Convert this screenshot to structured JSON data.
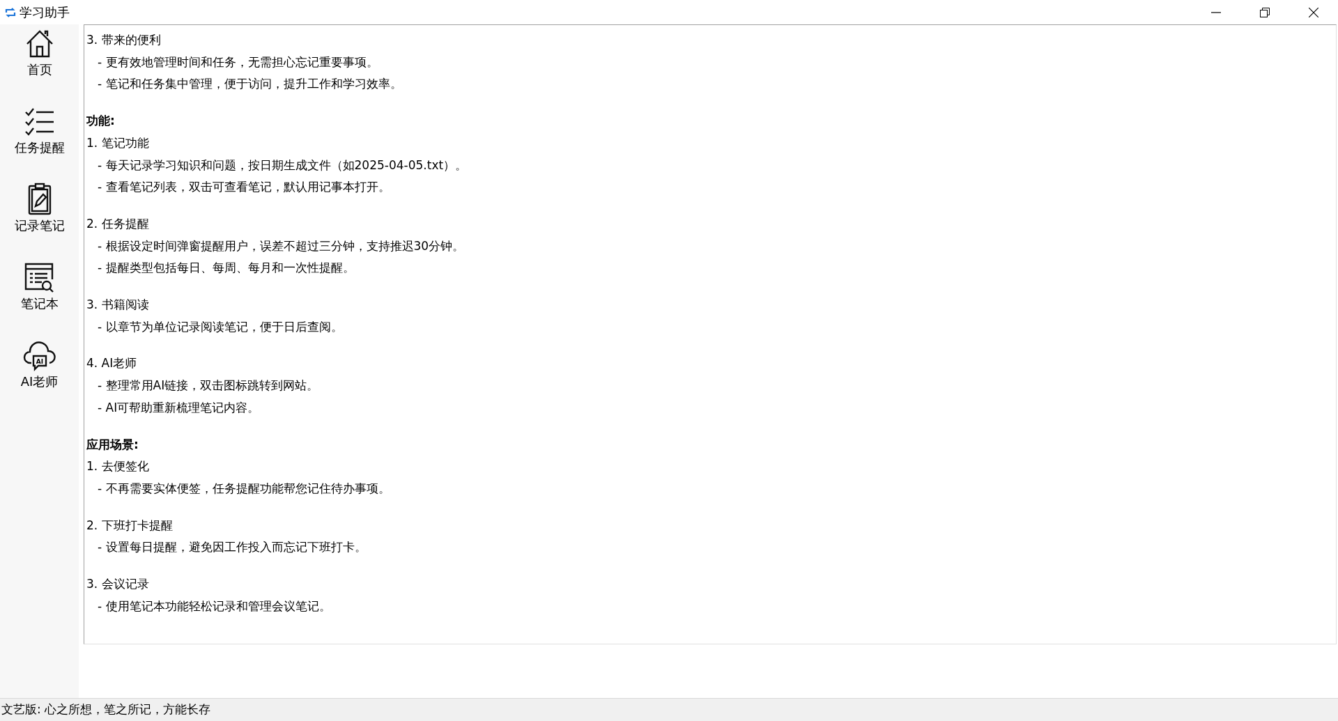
{
  "window": {
    "title": "学习助手"
  },
  "sidebar": {
    "items": [
      {
        "kind": "home",
        "label": "首页"
      },
      {
        "kind": "checklist",
        "label": "任务提醒"
      },
      {
        "kind": "clipboard",
        "label": "记录笔记"
      },
      {
        "kind": "notebook",
        "label": "笔记本"
      },
      {
        "kind": "cloud",
        "label": "AI老师",
        "icon_text": "AI"
      }
    ]
  },
  "content": {
    "groups": [
      {
        "items": [
          {
            "title": "3. 带来的便利",
            "bullets": [
              "- 更有效地管理时间和任务，无需担心忘记重要事项。",
              "- 笔记和任务集中管理，便于访问，提升工作和学习效率。"
            ]
          }
        ]
      },
      {
        "heading": "功能:",
        "items": [
          {
            "title": "1. 笔记功能",
            "bullets": [
              "- 每天记录学习知识和问题，按日期生成文件（如2025-04-05.txt）。",
              "- 查看笔记列表，双击可查看笔记，默认用记事本打开。"
            ]
          },
          {
            "title": "2. 任务提醒",
            "bullets": [
              "- 根据设定时间弹窗提醒用户，误差不超过三分钟，支持推迟30分钟。",
              "- 提醒类型包括每日、每周、每月和一次性提醒。"
            ]
          },
          {
            "title": "3. 书籍阅读",
            "bullets": [
              "- 以章节为单位记录阅读笔记，便于日后查阅。"
            ]
          },
          {
            "title": "4. AI老师",
            "bullets": [
              "- 整理常用AI链接，双击图标跳转到网站。",
              "- AI可帮助重新梳理笔记内容。"
            ]
          }
        ]
      },
      {
        "heading": "应用场景:",
        "items": [
          {
            "title": "1. 去便签化",
            "bullets": [
              "- 不再需要实体便签，任务提醒功能帮您记住待办事项。"
            ]
          },
          {
            "title": "2. 下班打卡提醒",
            "bullets": [
              "- 设置每日提醒，避免因工作投入而忘记下班打卡。"
            ]
          },
          {
            "title": "3. 会议记录",
            "bullets": [
              "- 使用笔记本功能轻松记录和管理会议笔记。"
            ]
          }
        ]
      }
    ]
  },
  "status_bar": {
    "text": "文艺版: 心之所想，笔之所记，方能长存"
  }
}
